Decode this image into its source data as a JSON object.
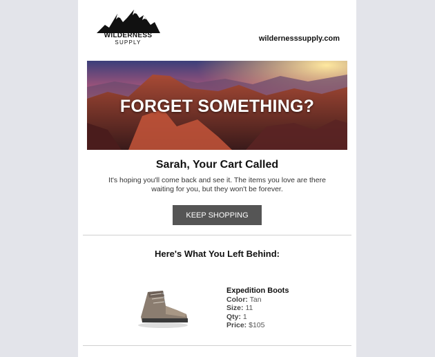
{
  "brand": {
    "logo_word": "WILDERNESS",
    "logo_sub": "SUPPLY",
    "site_url": "wildernesssupply.com"
  },
  "hero": {
    "title": "FORGET SOMETHING?"
  },
  "message": {
    "headline": "Sarah, Your Cart Called",
    "body": "It's hoping you'll come back and see it. The items you love are there waiting for you, but they won't be forever.",
    "cta_label": "KEEP SHOPPING"
  },
  "cart": {
    "section_title": "Here's What You Left Behind:",
    "items": [
      {
        "name": "Expedition Boots",
        "color_label": "Color:",
        "color": "Tan",
        "size_label": "Size:",
        "size": "11",
        "qty_label": "Qty:",
        "qty": "1",
        "price_label": "Price:",
        "price": "$105"
      }
    ]
  },
  "colors": {
    "page_bg": "#e3e4ea",
    "email_bg": "#ffffff",
    "button_bg": "#555555"
  }
}
